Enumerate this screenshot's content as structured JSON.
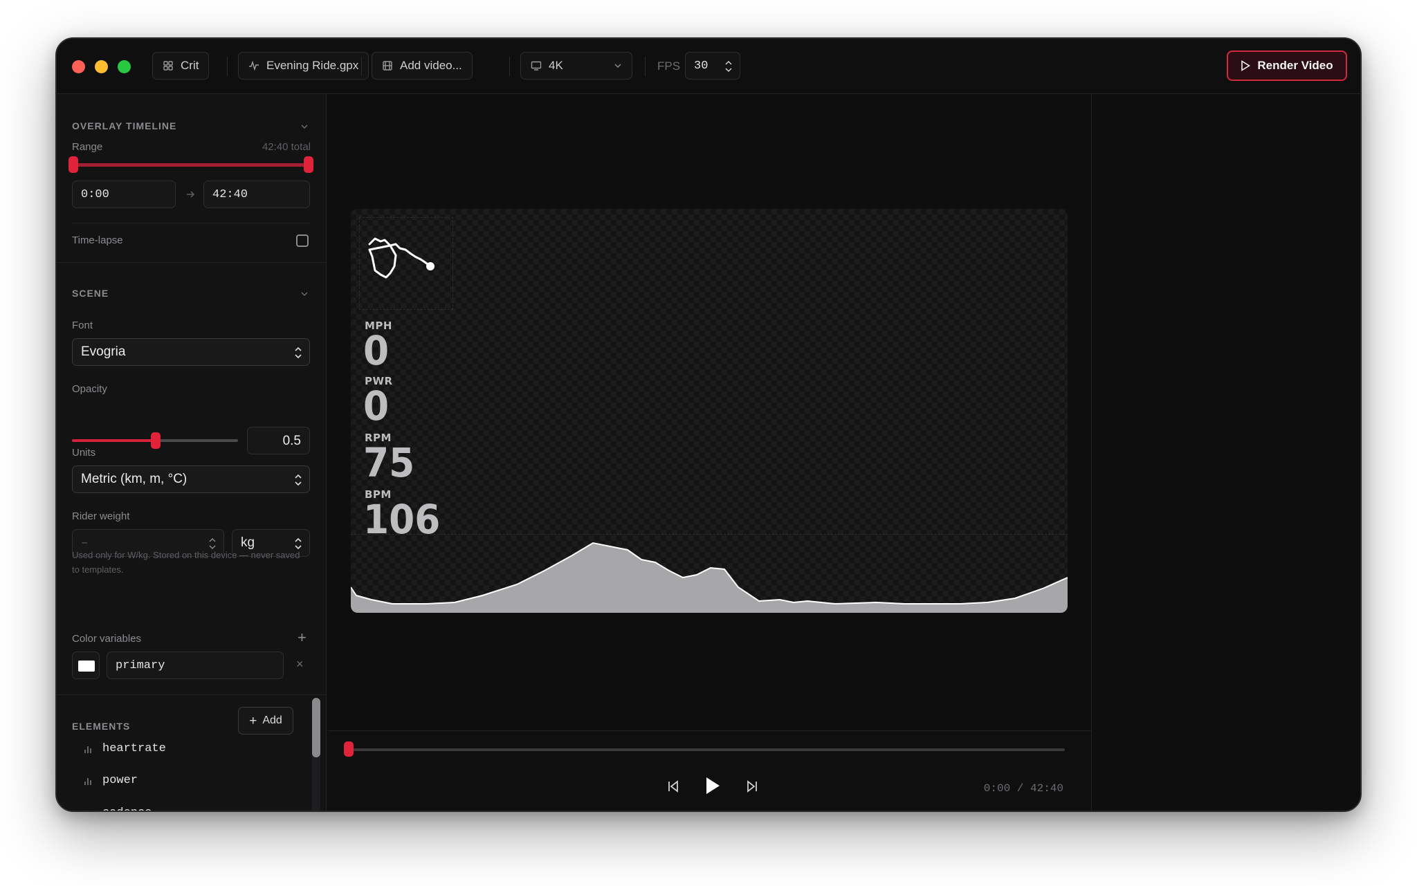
{
  "toolbar": {
    "project": "Crit",
    "file": "Evening Ride.gpx",
    "add_video": "Add video...",
    "resolution": "4K",
    "fps_label": "FPS",
    "fps_value": "30",
    "render": "Render Video"
  },
  "overlay_timeline": {
    "heading": "OVERLAY TIMELINE",
    "range_label": "Range",
    "range_total": "42:40 total",
    "start": "0:00",
    "end": "42:40",
    "timelapse_label": "Time-lapse",
    "timelapse_checked": false
  },
  "scene": {
    "heading": "SCENE",
    "font_label": "Font",
    "font_value": "Evogria",
    "opacity_label": "Opacity",
    "opacity_value": "0.5",
    "units_label": "Units",
    "units_value": "Metric (km, m, °C)",
    "rider_weight_label": "Rider weight",
    "rider_weight_value": "–",
    "rider_weight_unit": "kg",
    "rider_weight_note": "Used only for W/kg. Stored on this device — never saved to templates.",
    "color_vars_label": "Color variables",
    "color_var_name": "primary",
    "color_var_color": "#ffffff"
  },
  "elements": {
    "heading": "ELEMENTS",
    "add": "Add",
    "items": [
      "heartrate",
      "power",
      "cadence"
    ]
  },
  "overlay": {
    "metrics": [
      {
        "label": "MPH",
        "value": "0"
      },
      {
        "label": "PWR",
        "value": "0"
      },
      {
        "label": "RPM",
        "value": "75"
      },
      {
        "label": "BPM",
        "value": "106"
      }
    ]
  },
  "player": {
    "position": 0,
    "time": "0:00 / 42:40"
  },
  "colors": {
    "accent": "#e0233b",
    "bg": "#0e0e0f"
  }
}
